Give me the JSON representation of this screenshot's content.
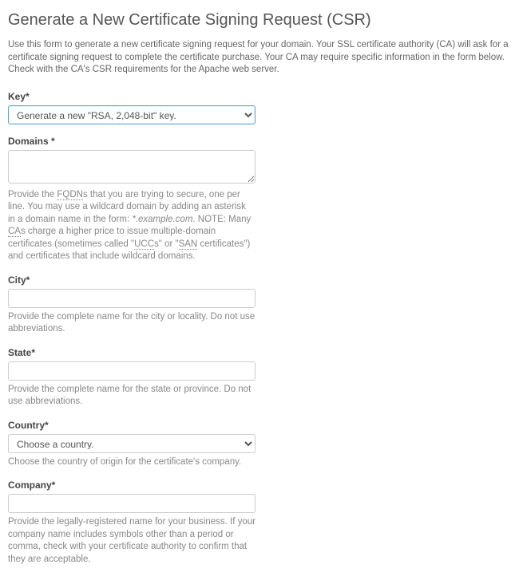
{
  "page": {
    "title": "Generate a New Certificate Signing Request (CSR)",
    "intro": "Use this form to generate a new certificate signing request for your domain. Your SSL certificate authority (CA) will ask for a certificate signing request to complete the certificate purchase. Your CA may require specific information in the form below. Check with the CA's CSR requirements for the Apache web server."
  },
  "key": {
    "label": "Key*",
    "value": "Generate a new \"RSA, 2,048-bit\" key."
  },
  "domains": {
    "label": "Domains *",
    "help1": "Provide the ",
    "fqdn": "FQDN",
    "help2": "s that you are trying to secure, one per line. You may use a wildcard domain by adding an asterisk in a domain name in the form: ",
    "example": "*.example.com",
    "help3": ". NOTE: Many ",
    "cas": "CA",
    "help4": "s charge a higher price to issue multiple-domain certificates (sometimes called \"",
    "ucc": "UCC",
    "help5": "s\" or \"",
    "san": "SAN",
    "help6": " certificates\") and certificates that include wildcard domains."
  },
  "city": {
    "label": "City*",
    "help": "Provide the complete name for the city or locality. Do not use abbreviations."
  },
  "state": {
    "label": "State*",
    "help": "Provide the complete name for the state or province. Do not use abbreviations."
  },
  "country": {
    "label": "Country*",
    "value": "Choose a country.",
    "help": "Choose the country of origin for the certificate's company."
  },
  "company": {
    "label": "Company*",
    "help": "Provide the legally-registered name for your business. If your company name includes symbols other than a period or comma, check with your certificate authority to confirm that they are acceptable."
  }
}
